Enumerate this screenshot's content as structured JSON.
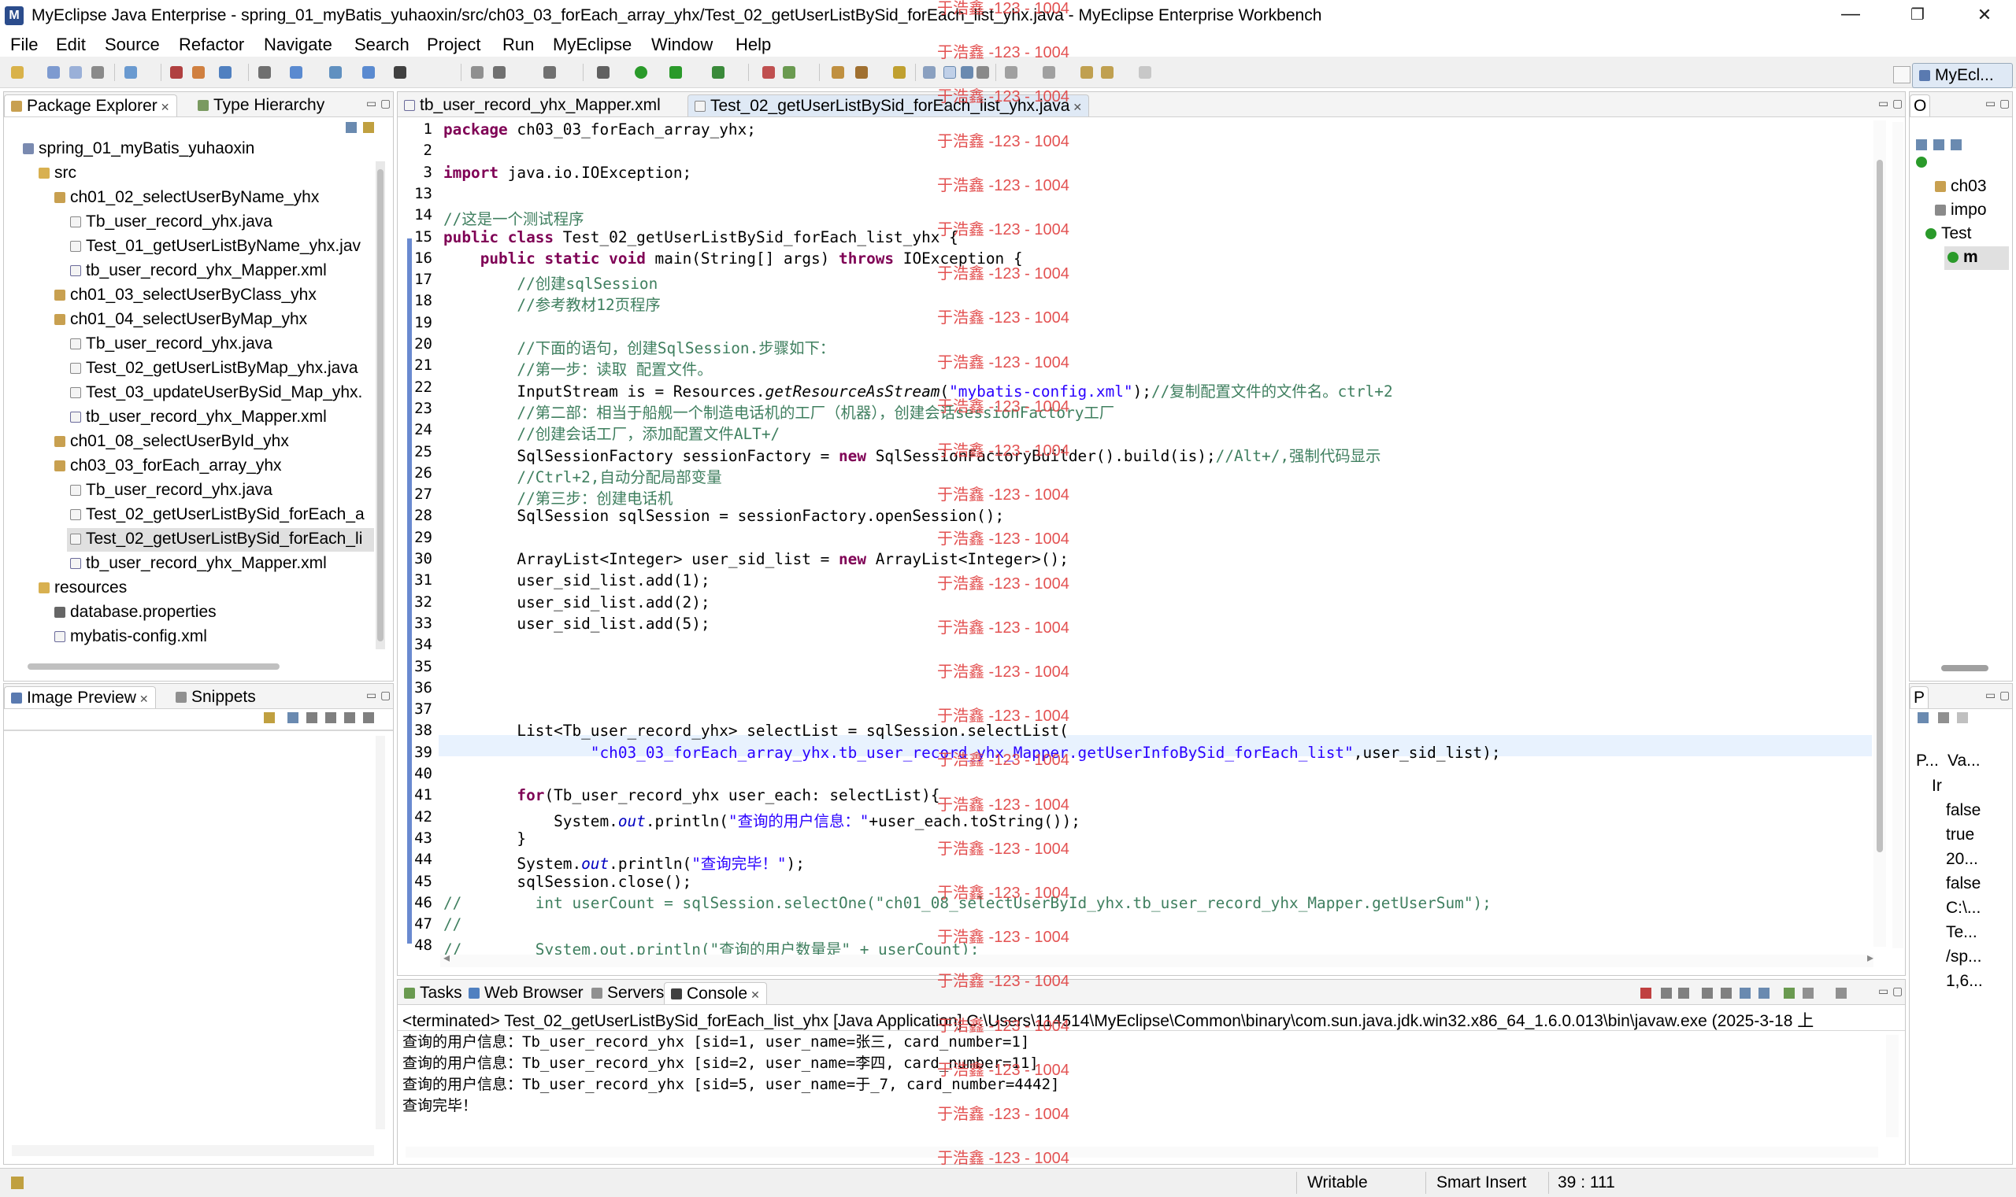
{
  "window": {
    "title": "MyEclipse Java Enterprise - spring_01_myBatis_yuhaoxin/src/ch03_03_forEach_array_yhx/Test_02_getUserListBySid_forEach_list_yhx.java - MyEclipse Enterprise Workbench",
    "minimize": "—",
    "restore": "❐",
    "close": "✕"
  },
  "menu": [
    "File",
    "Edit",
    "Source",
    "Refactor",
    "Navigate",
    "Search",
    "Project",
    "Run",
    "MyEclipse",
    "Window",
    "Help"
  ],
  "perspective": {
    "label": "MyEcl..."
  },
  "package_explorer": {
    "tabs": [
      "Package Explorer",
      "Type Hierarchy"
    ],
    "items": [
      {
        "label": "spring_01_myBatis_yuhaoxin",
        "icon": "project-icon"
      },
      {
        "label": "src",
        "icon": "source-folder-icon"
      },
      {
        "label": "ch01_02_selectUserByName_yhx",
        "icon": "package-icon"
      },
      {
        "label": "Tb_user_record_yhx.java",
        "icon": "java-file-icon"
      },
      {
        "label": "Test_01_getUserListByName_yhx.jav",
        "icon": "java-file-icon"
      },
      {
        "label": "tb_user_record_yhx_Mapper.xml",
        "icon": "xml-file-icon"
      },
      {
        "label": "ch01_03_selectUserByClass_yhx",
        "icon": "package-icon"
      },
      {
        "label": "ch01_04_selectUserByMap_yhx",
        "icon": "package-icon"
      },
      {
        "label": "Tb_user_record_yhx.java",
        "icon": "java-file-icon"
      },
      {
        "label": "Test_02_getUserListByMap_yhx.java",
        "icon": "java-file-icon"
      },
      {
        "label": "Test_03_updateUserBySid_Map_yhx.",
        "icon": "java-file-icon"
      },
      {
        "label": "tb_user_record_yhx_Mapper.xml",
        "icon": "xml-file-icon"
      },
      {
        "label": "ch01_08_selectUserById_yhx",
        "icon": "package-icon"
      },
      {
        "label": "ch03_03_forEach_array_yhx",
        "icon": "package-icon"
      },
      {
        "label": "Tb_user_record_yhx.java",
        "icon": "java-file-icon"
      },
      {
        "label": "Test_02_getUserListBySid_forEach_a",
        "icon": "java-file-icon"
      },
      {
        "label": "Test_02_getUserListBySid_forEach_li",
        "icon": "java-file-icon"
      },
      {
        "label": "tb_user_record_yhx_Mapper.xml",
        "icon": "xml-file-icon"
      },
      {
        "label": "resources",
        "icon": "folder-icon"
      },
      {
        "label": "database.properties",
        "icon": "properties-file-icon"
      },
      {
        "label": "mybatis-config.xml",
        "icon": "xml-file-icon"
      }
    ]
  },
  "image_preview": {
    "tabs": [
      "Image Preview",
      "Snippets"
    ]
  },
  "editor": {
    "tabs": [
      "tb_user_record_yhx_Mapper.xml",
      "Test_02_getUserListBySid_forEach_list_yhx.java"
    ],
    "lines": [
      {
        "n": "1",
        "text": "package ch03_03_forEach_array_yhx;"
      },
      {
        "n": "2",
        "text": ""
      },
      {
        "n": "3",
        "text": "import java.io.IOException;"
      },
      {
        "n": "13",
        "text": ""
      },
      {
        "n": "14",
        "text": "//这是一个测试程序"
      },
      {
        "n": "15",
        "text": "public class Test_02_getUserListBySid_forEach_list_yhx {"
      },
      {
        "n": "16",
        "text": "    public static void main(String[] args) throws IOException {"
      },
      {
        "n": "17",
        "text": "        //创建sqlSession"
      },
      {
        "n": "18",
        "text": "        //参考教材12页程序"
      },
      {
        "n": "19",
        "text": ""
      },
      {
        "n": "20",
        "text": "        //下面的语句，创建SqlSession.步骤如下："
      },
      {
        "n": "21",
        "text": "        //第一步：读取 配置文件。"
      },
      {
        "n": "22",
        "text": "        InputStream is = Resources.getResourceAsStream(\"mybatis-config.xml\");//复制配置文件的文件名。ctrl+2"
      },
      {
        "n": "23",
        "text": "        //第二部：相当于船舰一个制造电话机的工厂（机器），创建会话sessionFactory工厂"
      },
      {
        "n": "24",
        "text": "        //创建会话工厂，添加配置文件ALT+/"
      },
      {
        "n": "25",
        "text": "        SqlSessionFactory sessionFactory = new SqlSessionFactoryBuilder().build(is);//Alt+/,强制代码显示"
      },
      {
        "n": "26",
        "text": "        //Ctrl+2,自动分配局部变量"
      },
      {
        "n": "27",
        "text": "        //第三步：创建电话机"
      },
      {
        "n": "28",
        "text": "        SqlSession sqlSession = sessionFactory.openSession();"
      },
      {
        "n": "29",
        "text": ""
      },
      {
        "n": "30",
        "text": "        ArrayList<Integer> user_sid_list = new ArrayList<Integer>();"
      },
      {
        "n": "31",
        "text": "        user_sid_list.add(1);"
      },
      {
        "n": "32",
        "text": "        user_sid_list.add(2);"
      },
      {
        "n": "33",
        "text": "        user_sid_list.add(5);"
      },
      {
        "n": "34",
        "text": ""
      },
      {
        "n": "35",
        "text": ""
      },
      {
        "n": "36",
        "text": ""
      },
      {
        "n": "37",
        "text": ""
      },
      {
        "n": "38",
        "text": "        List<Tb_user_record_yhx> selectList = sqlSession.selectList("
      },
      {
        "n": "39",
        "text": "                \"ch03_03_forEach_array_yhx.tb_user_record_yhx_Mapper.getUserInfoBySid_forEach_list\",user_sid_list);"
      },
      {
        "n": "40",
        "text": ""
      },
      {
        "n": "41",
        "text": "        for(Tb_user_record_yhx user_each: selectList){"
      },
      {
        "n": "42",
        "text": "            System.out.println(\"查询的用户信息：\"+user_each.toString());"
      },
      {
        "n": "43",
        "text": "        }"
      },
      {
        "n": "44",
        "text": "        System.out.println(\"查询完毕！\");"
      },
      {
        "n": "45",
        "text": "        sqlSession.close();"
      },
      {
        "n": "46",
        "text": "//        int userCount = sqlSession.selectOne(\"ch01_08_selectUserById_yhx.tb_user_record_yhx_Mapper.getUserSum\");"
      },
      {
        "n": "47",
        "text": "//"
      },
      {
        "n": "48",
        "text": "//        System.out.println(\"查询的用户数量是\" + userCount);"
      }
    ]
  },
  "watermark": "于浩鑫 -123 - 1004",
  "bottom_panel": {
    "tabs": [
      "Tasks",
      "Web Browser",
      "Servers",
      "Console"
    ],
    "header": "<terminated> Test_02_getUserListBySid_forEach_list_yhx [Java Application] C:\\Users\\114514\\MyEclipse\\Common\\binary\\com.sun.java.jdk.win32.x86_64_1.6.0.013\\bin\\javaw.exe (2025-3-18 上",
    "lines": [
      "查询的用户信息：Tb_user_record_yhx [sid=1, user_name=张三, card_number=1]",
      "查询的用户信息：Tb_user_record_yhx [sid=2, user_name=李四, card_number=11]",
      "查询的用户信息：Tb_user_record_yhx [sid=5, user_name=于_7, card_number=4442]",
      "查询完毕！"
    ]
  },
  "outline": {
    "items": [
      "ch03",
      "impo",
      "Test",
      "m"
    ]
  },
  "properties": {
    "header": [
      "P...",
      "Va..."
    ],
    "rows": [
      "Ir",
      "false",
      "true",
      "20...",
      "false",
      "C:\\...",
      "Te...",
      "/sp...",
      "1,6..."
    ]
  },
  "status": {
    "writable": "Writable",
    "insert_mode": "Smart Insert",
    "position": "39 : 111"
  },
  "colors": {
    "keyword": "#7f0055",
    "comment": "#3f7f5f",
    "string": "#2a00ff",
    "watermark": "#e04040",
    "current_line": "#e8f2fe"
  }
}
